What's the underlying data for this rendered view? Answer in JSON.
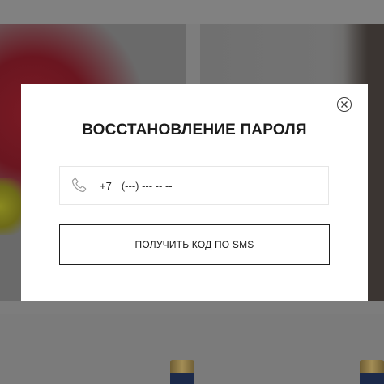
{
  "modal": {
    "title": "ВОССТАНОВЛЕНИЕ ПАРОЛЯ",
    "close_icon": "close-circle-icon",
    "phone": {
      "icon": "phone-icon",
      "prefix": "+7",
      "value": "",
      "placeholder": "(---) --- -- --"
    },
    "submit_label": "ПОЛУЧИТЬ КОД ПО SMS"
  },
  "colors": {
    "overlay": "#7d7d7d",
    "modal_bg": "#ffffff",
    "text": "#1b1b1b",
    "field_border": "#e6e6e6",
    "button_border": "#1e1e1e"
  }
}
